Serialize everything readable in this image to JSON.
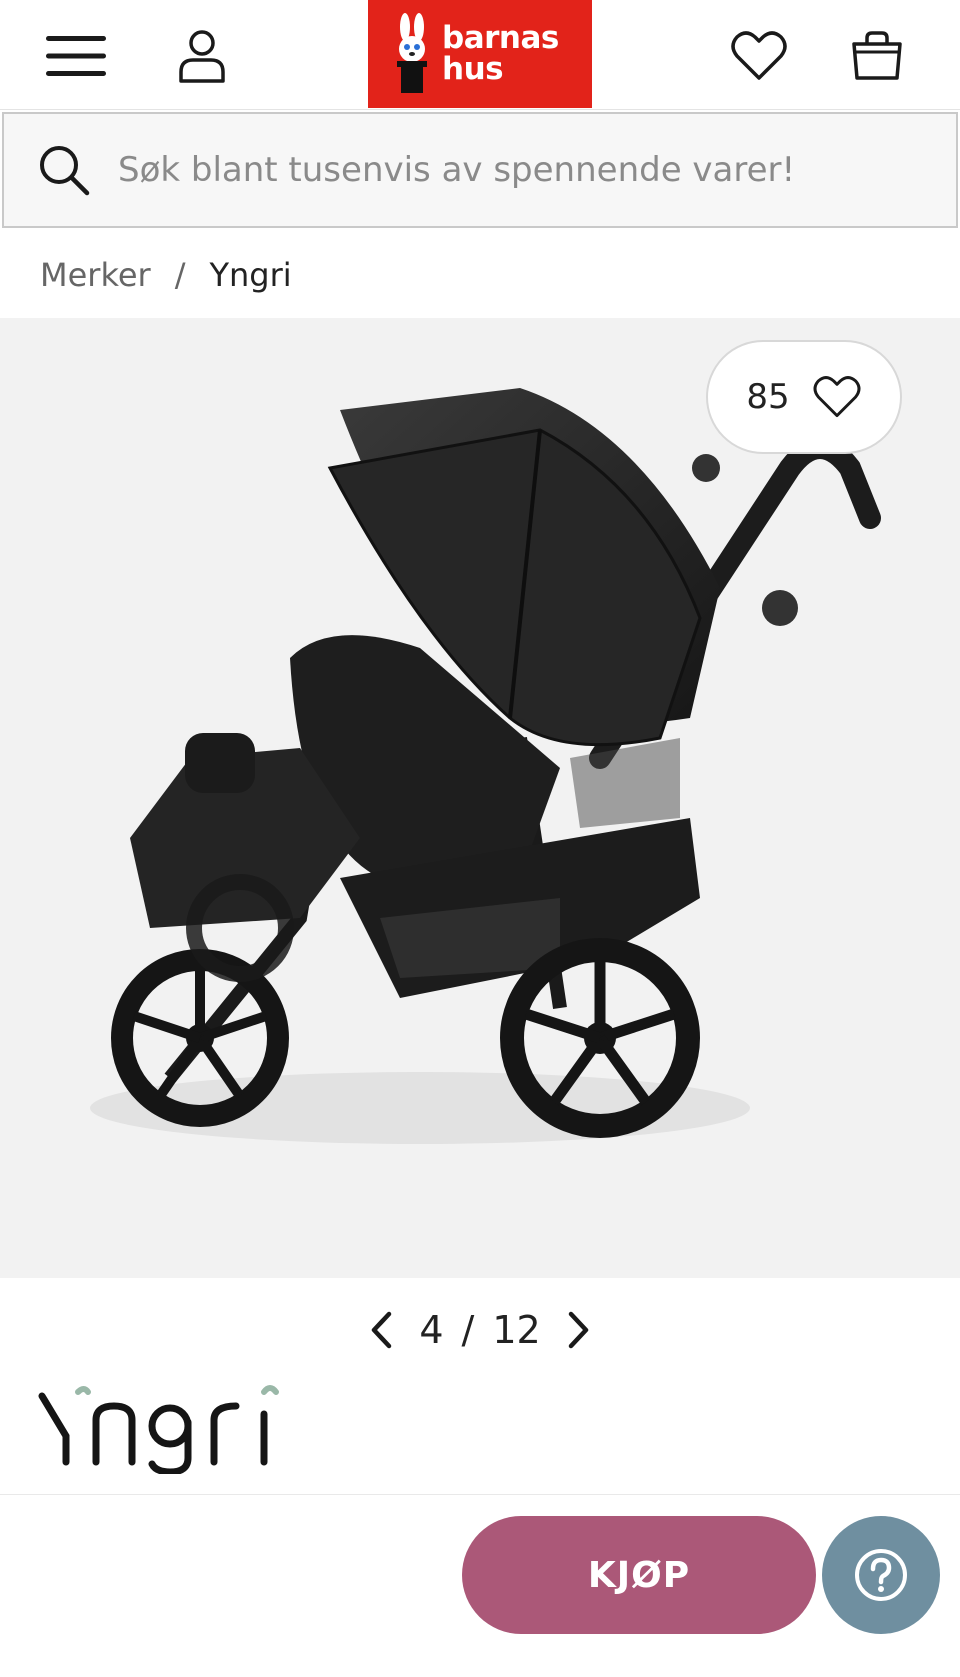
{
  "header": {
    "menu_icon": "hamburger-menu-icon",
    "account_icon": "user-icon",
    "wishlist_icon": "heart-icon",
    "cart_icon": "shopping-bag-icon",
    "logo": {
      "line1": "barnas",
      "line2": "hus",
      "background": "#e2231a",
      "mascot_icon": "rabbit-in-hat-icon"
    }
  },
  "search": {
    "placeholder": "Søk blant tusenvis av spennende varer!",
    "icon": "search-icon"
  },
  "breadcrumb": {
    "items": [
      "Merker",
      "Yngri"
    ],
    "separator": "/"
  },
  "gallery": {
    "like_count": "85",
    "like_icon": "heart-outline-icon",
    "current_image": "4",
    "separator": "/",
    "total_images": "12",
    "image_alt": "black double jogging stroller"
  },
  "brand": {
    "name": "Yngri"
  },
  "actions": {
    "buy_label": "KJØP",
    "buy_color": "#ab5878",
    "help_icon": "question-mark-icon",
    "help_color": "#6f8fa0"
  }
}
